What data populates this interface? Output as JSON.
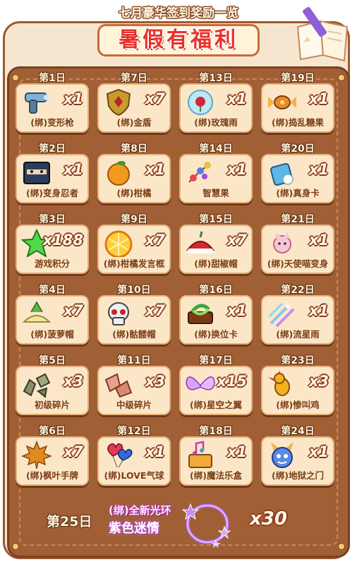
{
  "header": {
    "title": "七月豪华签到奖励一览",
    "banner": "暑假有福利"
  },
  "rewards": [
    {
      "day": "第1日",
      "qty": "x1",
      "name": "(绑)变形枪",
      "icon": "gun-icon"
    },
    {
      "day": "第7日",
      "qty": "x7",
      "name": "(绑)金盾",
      "icon": "shield-icon"
    },
    {
      "day": "第13日",
      "qty": "x1",
      "name": "(绑)玫瑰雨",
      "icon": "rose-bubble-icon"
    },
    {
      "day": "第19日",
      "qty": "x1",
      "name": "(绑)捣乱糖果",
      "icon": "candy-icon"
    },
    {
      "day": "第2日",
      "qty": "x1",
      "name": "(绑)变身忍者",
      "icon": "ninja-icon"
    },
    {
      "day": "第8日",
      "qty": "x1",
      "name": "(绑)柑橘",
      "icon": "orange-icon"
    },
    {
      "day": "第14日",
      "qty": "x1",
      "name": "智慧果",
      "icon": "berry-branch-icon"
    },
    {
      "day": "第20日",
      "qty": "x1",
      "name": "(绑)真身卡",
      "icon": "glove-card-icon"
    },
    {
      "day": "第3日",
      "qty": "x188",
      "name": "游戏积分",
      "icon": "star-icon"
    },
    {
      "day": "第9日",
      "qty": "x7",
      "name": "(绑)柑橘发言框",
      "icon": "orange-slice-icon"
    },
    {
      "day": "第15日",
      "qty": "x7",
      "name": "(绑)甜椒帽",
      "icon": "pepper-hat-icon"
    },
    {
      "day": "第21日",
      "qty": "x1",
      "name": "(绑)天使喵变身",
      "icon": "angel-cat-icon"
    },
    {
      "day": "第4日",
      "qty": "x7",
      "name": "(绑)菠萝帽",
      "icon": "pineapple-hat-icon"
    },
    {
      "day": "第10日",
      "qty": "x7",
      "name": "(绑)骷髅帽",
      "icon": "skull-icon"
    },
    {
      "day": "第16日",
      "qty": "x1",
      "name": "(绑)换位卡",
      "icon": "swap-card-icon"
    },
    {
      "day": "第22日",
      "qty": "x1",
      "name": "(绑)流星雨",
      "icon": "meteor-icon"
    },
    {
      "day": "第5日",
      "qty": "x3",
      "name": "初级碎片",
      "icon": "shard-gray-icon"
    },
    {
      "day": "第11日",
      "qty": "x3",
      "name": "中级碎片",
      "icon": "shard-pink-icon"
    },
    {
      "day": "第17日",
      "qty": "x15",
      "name": "(绑)星空之翼",
      "icon": "wings-icon"
    },
    {
      "day": "第23日",
      "qty": "x3",
      "name": "(绑)惨叫鸡",
      "icon": "rubber-chicken-icon"
    },
    {
      "day": "第6日",
      "qty": "x7",
      "name": "(绑)枫叶手牌",
      "icon": "maple-leaf-icon"
    },
    {
      "day": "第12日",
      "qty": "x1",
      "name": "(绑)LOVE气球",
      "icon": "love-balloon-icon"
    },
    {
      "day": "第18日",
      "qty": "x1",
      "name": "(绑)魔法乐盒",
      "icon": "music-box-icon"
    },
    {
      "day": "第24日",
      "qty": "x1",
      "name": "(绑)地狱之门",
      "icon": "blue-monster-icon"
    }
  ],
  "final_reward": {
    "day": "第25日",
    "subtitle": "(绑)全新光环",
    "name": "紫色迷情",
    "qty": "x30",
    "icon": "purple-halo-icon"
  },
  "colors": {
    "board": "#a15f35",
    "card": "#fbe7c8",
    "banner_text": "#e8322a"
  }
}
